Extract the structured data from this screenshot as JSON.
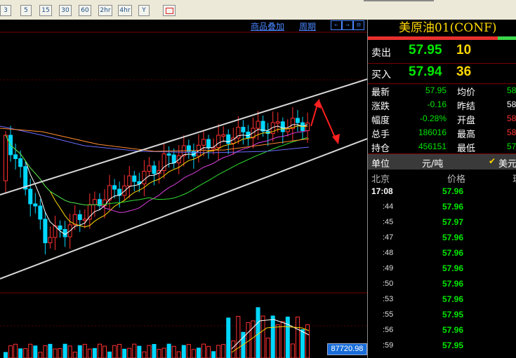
{
  "toolbar": {
    "periods": [
      "3",
      "5",
      "15",
      "30",
      "60",
      "2hr",
      "4hr",
      "Y"
    ]
  },
  "chart_header": {
    "overlay_label": "商品叠加",
    "cycle_label": "周期"
  },
  "volume_value": "87720.98",
  "quote": {
    "title": "美原油01(CONF)",
    "sell_label": "卖出",
    "sell_price": "57.95",
    "sell_volume": "10",
    "buy_label": "买入",
    "buy_price": "57.94",
    "buy_volume": "36",
    "rows": [
      {
        "l1": "最新",
        "v1": "57.95",
        "l2": "均价",
        "v2": "58",
        "c2": "#00e700"
      },
      {
        "l1": "涨跌",
        "v1": "-0.16",
        "l2": "昨结",
        "v2": "58",
        "c2": "#ffffff"
      },
      {
        "l1": "幅度",
        "v1": "-0.28%",
        "l2": "开盘",
        "v2": "58",
        "c2": "#ff3030"
      },
      {
        "l1": "总手",
        "v1": "186016",
        "l2": "最高",
        "v2": "58",
        "c2": "#ff3030"
      },
      {
        "l1": "持仓",
        "v1": "456151",
        "l2": "最低",
        "v2": "57",
        "c2": "#00e700"
      }
    ],
    "unit_label": "单位",
    "unit_value": "元/吨",
    "currency_check": "✔",
    "currency_label": "美元",
    "table_header": {
      "place": "北京",
      "price": "价格",
      "third": "现"
    },
    "ticks": [
      {
        "time": "17:08",
        "price": "57.96"
      },
      {
        "time": ":44",
        "price": "57.96"
      },
      {
        "time": ":45",
        "price": "57.97"
      },
      {
        "time": ":47",
        "price": "57.96"
      },
      {
        "time": ":48",
        "price": "57.96"
      },
      {
        "time": ":49",
        "price": "57.96"
      },
      {
        "time": ":50",
        "price": "57.96"
      },
      {
        "time": ":53",
        "price": "57.96"
      },
      {
        "time": ":55",
        "price": "57.95"
      },
      {
        "time": ":56",
        "price": "57.96"
      },
      {
        "time": ":59",
        "price": "57.95"
      }
    ]
  },
  "colors": {
    "up": "#ff3030",
    "down": "#00d7ff",
    "quote_green": "#00e700",
    "quote_yellow": "#ffd800",
    "trendline": "#d8d8d8",
    "arrow": "#ff2020"
  }
}
